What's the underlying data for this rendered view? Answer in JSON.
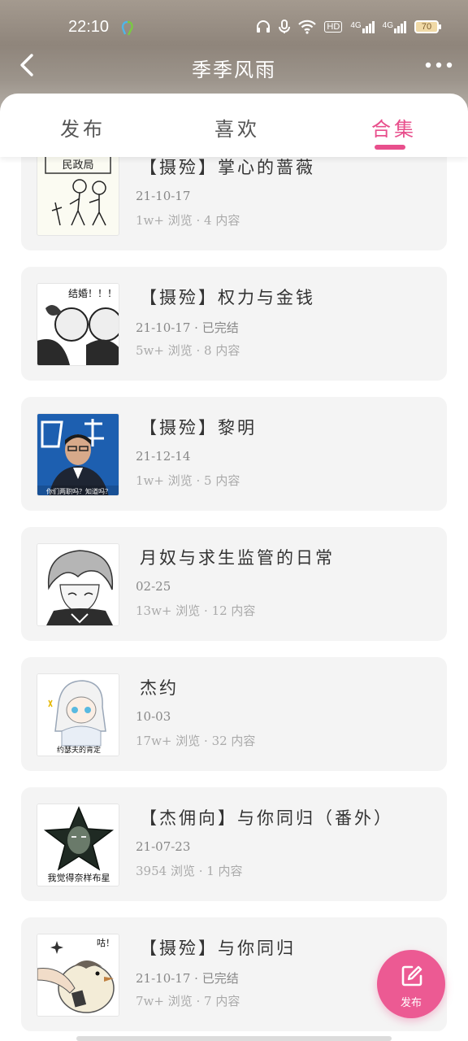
{
  "status_bar": {
    "time": "22:10",
    "network_1": "4G",
    "network_2": "4G",
    "hd_label": "HD",
    "battery": "70"
  },
  "nav": {
    "title": "季季风雨"
  },
  "tabs": [
    {
      "label": "发布"
    },
    {
      "label": "喜欢"
    },
    {
      "label": "合集"
    }
  ],
  "active_tab": "合集",
  "collections": [
    {
      "title": "【摄殓】掌心的蔷薇",
      "date": "21-10-17",
      "stats": "1w+ 浏览 · 4 内容",
      "thumb_caption": "民政局"
    },
    {
      "title": "【摄殓】权力与金钱",
      "date": "21-10-17 · 已完结",
      "stats": "5w+ 浏览 · 8 内容",
      "thumb_caption": "结婚！！！"
    },
    {
      "title": "【摄殓】黎明",
      "date": "21-12-14",
      "stats": "1w+ 浏览 · 5 内容",
      "thumb_caption": "你们两职吗？知道吗？"
    },
    {
      "title": "月奴与求生监管的日常",
      "date": "02-25",
      "stats": "13w+ 浏览 · 12 内容",
      "thumb_caption": ""
    },
    {
      "title": "杰约",
      "date": "10-03",
      "stats": "17w+ 浏览 · 32 内容",
      "thumb_caption": "约瑟夫的肯定"
    },
    {
      "title": "【杰佣向】与你同归（番外）",
      "date": "21-07-23",
      "stats": "3954 浏览 · 1 内容",
      "thumb_caption": "我觉得奈样布星"
    },
    {
      "title": "【摄殓】与你同归",
      "date": "21-10-17 · 已完结",
      "stats": "7w+ 浏览 · 7 内容",
      "thumb_caption": "咕！"
    }
  ],
  "fab": {
    "label": "发布"
  },
  "colors": {
    "accent": "#e84f8c",
    "card_bg": "#f4f4f4"
  }
}
